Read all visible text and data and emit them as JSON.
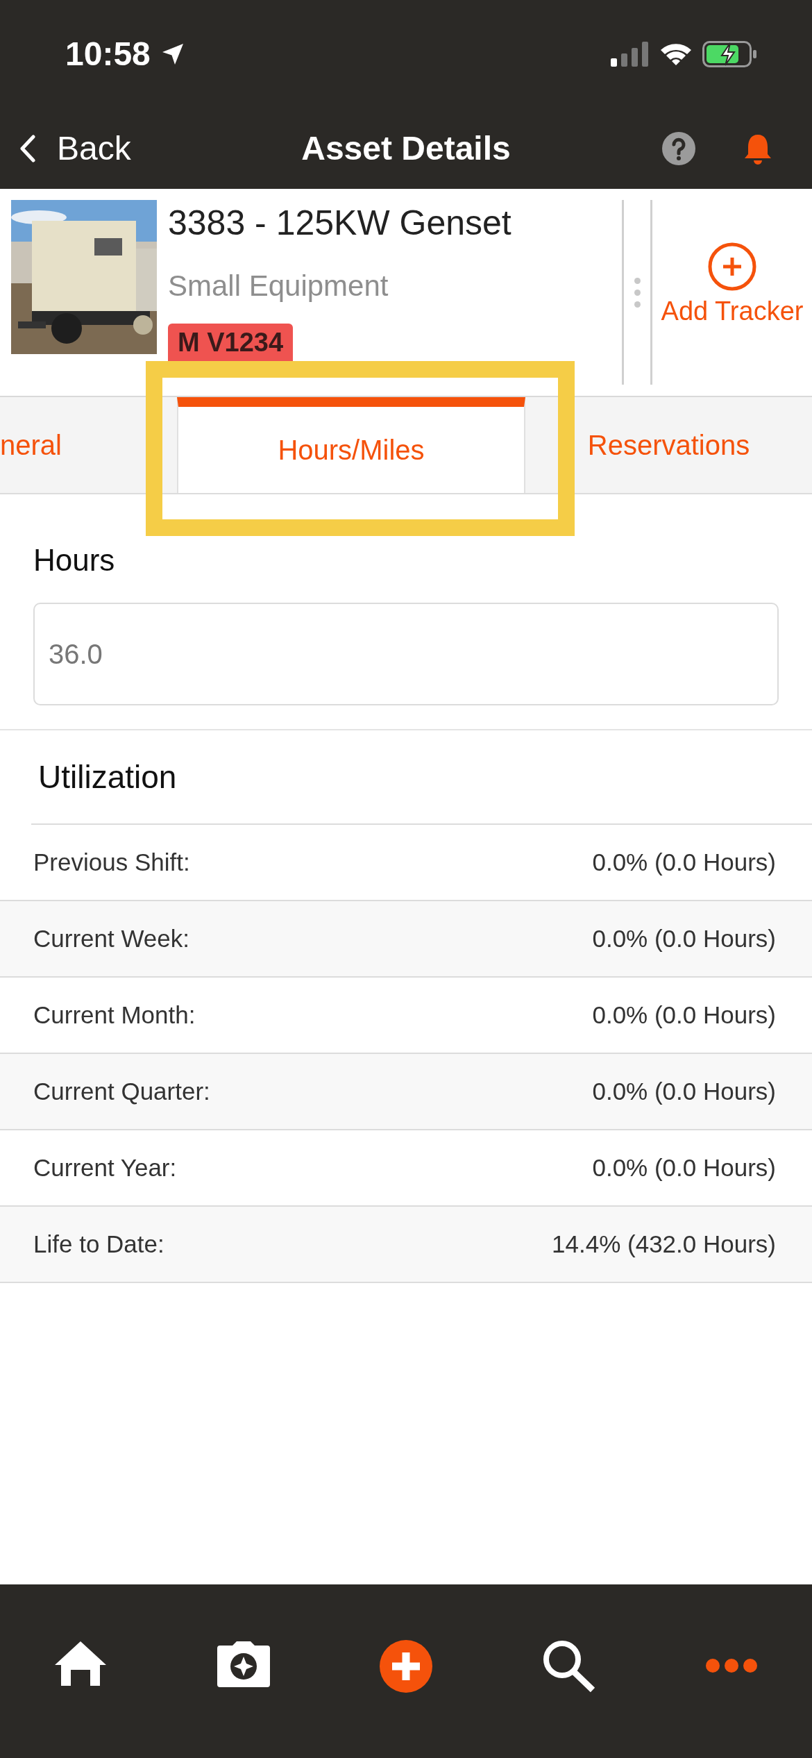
{
  "status_bar": {
    "time": "10:58"
  },
  "nav": {
    "back": "Back",
    "title": "Asset Details"
  },
  "asset": {
    "title": "3383 - 125KW Genset",
    "category": "Small Equipment",
    "tag": "M V1234",
    "tracker_button": "Add Tracker"
  },
  "tabs": [
    {
      "label": "neral",
      "selected": false
    },
    {
      "label": "Hours/Miles",
      "selected": true
    },
    {
      "label": "Reservations",
      "selected": false
    }
  ],
  "hours": {
    "label": "Hours",
    "value": "36.0"
  },
  "utilization": {
    "title": "Utilization",
    "rows": [
      {
        "label": "Previous Shift:",
        "value": "0.0% (0.0 Hours)"
      },
      {
        "label": "Current Week:",
        "value": "0.0% (0.0 Hours)"
      },
      {
        "label": "Current Month:",
        "value": "0.0% (0.0 Hours)"
      },
      {
        "label": "Current Quarter:",
        "value": "0.0% (0.0 Hours)"
      },
      {
        "label": "Current Year:",
        "value": "0.0% (0.0 Hours)"
      },
      {
        "label": "Life to Date:",
        "value": "14.4% (432.0 Hours)"
      }
    ]
  },
  "bottom_nav": [
    {
      "kind": "home",
      "selected": false
    },
    {
      "kind": "camera",
      "selected": false
    },
    {
      "kind": "add",
      "selected": false
    },
    {
      "kind": "search",
      "selected": false
    },
    {
      "kind": "more",
      "selected": true
    }
  ]
}
